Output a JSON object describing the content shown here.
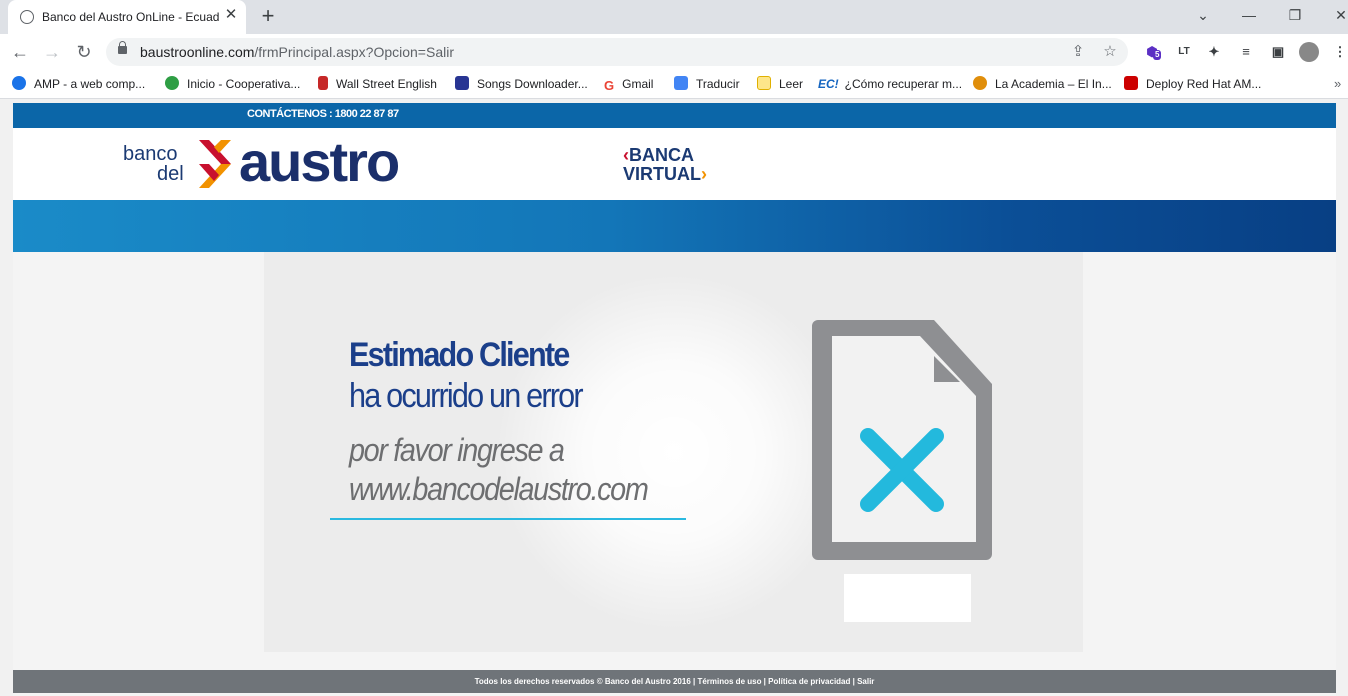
{
  "browser": {
    "tab_title": "Banco del Austro OnLine - Ecuad",
    "tab_close": "✕",
    "new_tab": "+",
    "url_host": "baustroonline.com",
    "url_path": "/frmPrincipal.aspx?Opcion=Salir",
    "extension_badge": "5",
    "extension_lt": "LT"
  },
  "bookmarks": [
    {
      "label": "AMP - a web comp...",
      "color": "#1a73e8"
    },
    {
      "label": "Inicio - Cooperativa...",
      "color": "#2e9e44"
    },
    {
      "label": "Wall Street English",
      "color": "#c62828"
    },
    {
      "label": "Songs Downloader...",
      "color": "#283593"
    },
    {
      "label": "Gmail",
      "color": "#ea4335"
    },
    {
      "label": "Traducir",
      "color": "#4285f4"
    },
    {
      "label": "Leer",
      "color": "#fbc02d"
    },
    {
      "label": "¿Cómo recuperar m...",
      "color": "#1565c0",
      "prefix": "EC!"
    },
    {
      "label": "La Academia – El In...",
      "color": "#e08e0b"
    },
    {
      "label": "Deploy Red Hat AM...",
      "color": "#cc0000"
    }
  ],
  "site": {
    "contact": "CONTÁCTENOS : 1800 22 87 87",
    "logo_banco": "banco",
    "logo_del": "del",
    "logo_austro": "austro",
    "banca": "BANCA",
    "virtual": "VIRTUAL"
  },
  "error": {
    "line1": "Estimado Cliente",
    "line2": "ha ocurrido un error",
    "line3": "por favor ingrese a",
    "line4": "www.bancodelaustro.com"
  },
  "footer": {
    "text": "Todos los derechos reservados © Banco del Austro 2016 | Términos de uso | Política de privacidad | Salir"
  },
  "colors": {
    "brand_blue": "#1b3f8a",
    "accent_cyan": "#2ab9e0",
    "logo_red": "#c8102e",
    "logo_orange": "#f29200"
  }
}
